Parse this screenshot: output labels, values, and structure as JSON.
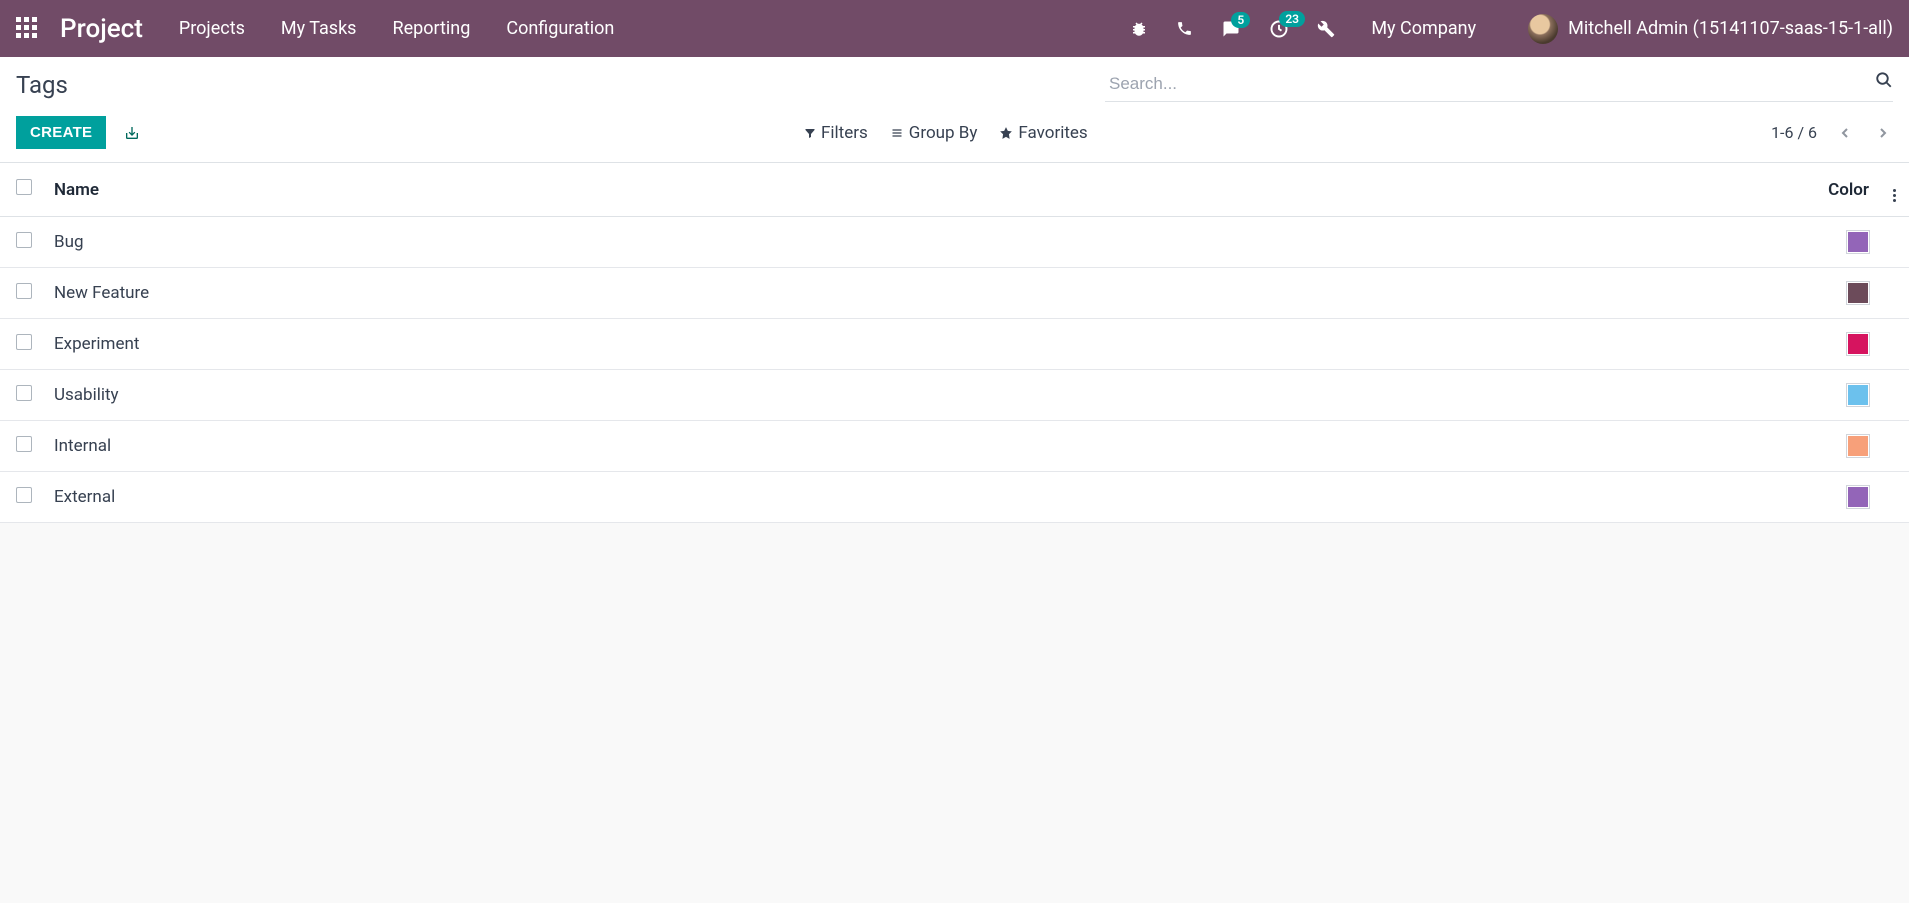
{
  "topbar": {
    "brand": "Project",
    "nav": [
      "Projects",
      "My Tasks",
      "Reporting",
      "Configuration"
    ],
    "chat_badge": "5",
    "activity_badge": "23",
    "company": "My Company",
    "user": "Mitchell Admin (15141107-saas-15-1-all)"
  },
  "control": {
    "title": "Tags",
    "search_placeholder": "Search...",
    "create_label": "CREATE",
    "filters_label": "Filters",
    "groupby_label": "Group By",
    "favorites_label": "Favorites",
    "pager": "1-6 / 6"
  },
  "table": {
    "col_name": "Name",
    "col_color": "Color",
    "rows": [
      {
        "name": "Bug",
        "color": "#9365b8"
      },
      {
        "name": "New Feature",
        "color": "#6c4b5a"
      },
      {
        "name": "Experiment",
        "color": "#d6145f"
      },
      {
        "name": "Usability",
        "color": "#6cc1ed"
      },
      {
        "name": "Internal",
        "color": "#f7a07a"
      },
      {
        "name": "External",
        "color": "#9365b8"
      }
    ]
  }
}
